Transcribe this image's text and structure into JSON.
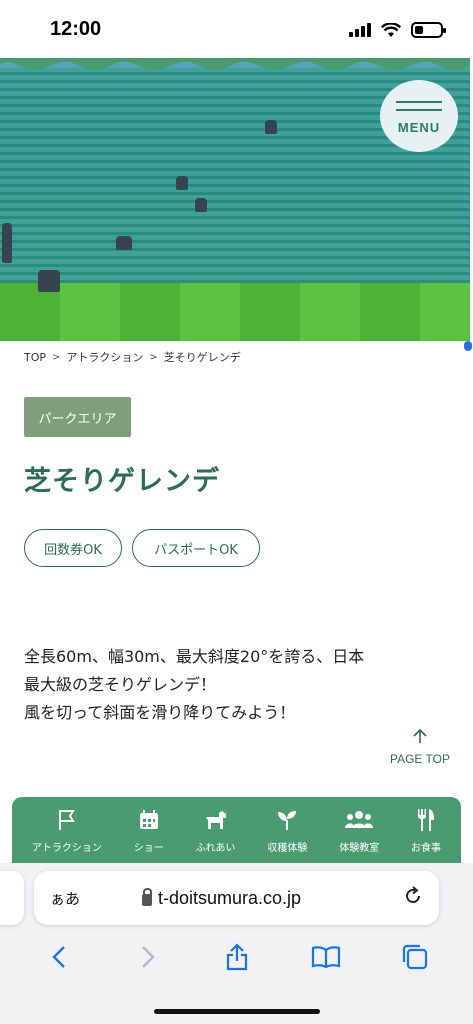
{
  "status_bar": {
    "time": "12:00"
  },
  "header": {
    "menu_label": "MENU"
  },
  "breadcrumb": {
    "items": [
      "TOP",
      "アトラクション",
      "芝そりゲレンデ"
    ]
  },
  "tag": "パークエリア",
  "title": "芝そりゲレンデ",
  "badges": [
    "回数券OK",
    "パスポートOK"
  ],
  "description": {
    "line1": "全長60m、幅30m、最大斜度20°を誇る、日本",
    "line2": "最大級の芝そりゲレンデ！",
    "line3": "風を切って斜面を滑り降りてみよう！"
  },
  "page_top": {
    "label": "PAGE TOP"
  },
  "bottom_nav": {
    "items": [
      {
        "label": "アトラクション",
        "icon": "flag-icon"
      },
      {
        "label": "ショー",
        "icon": "calendar-icon"
      },
      {
        "label": "ふれあい",
        "icon": "dog-icon"
      },
      {
        "label": "収穫体験",
        "icon": "sprout-icon"
      },
      {
        "label": "体験教室",
        "icon": "people-icon"
      },
      {
        "label": "お食事",
        "icon": "fork-knife-icon"
      }
    ]
  },
  "browser": {
    "aa": "ぁあ",
    "url": "t-doitsumura.co.jp"
  },
  "colors": {
    "brand_green": "#2e6b58",
    "nav_green": "#4a9c70",
    "tag_green": "#7f9f7a",
    "link_blue": "#1a73e8"
  }
}
